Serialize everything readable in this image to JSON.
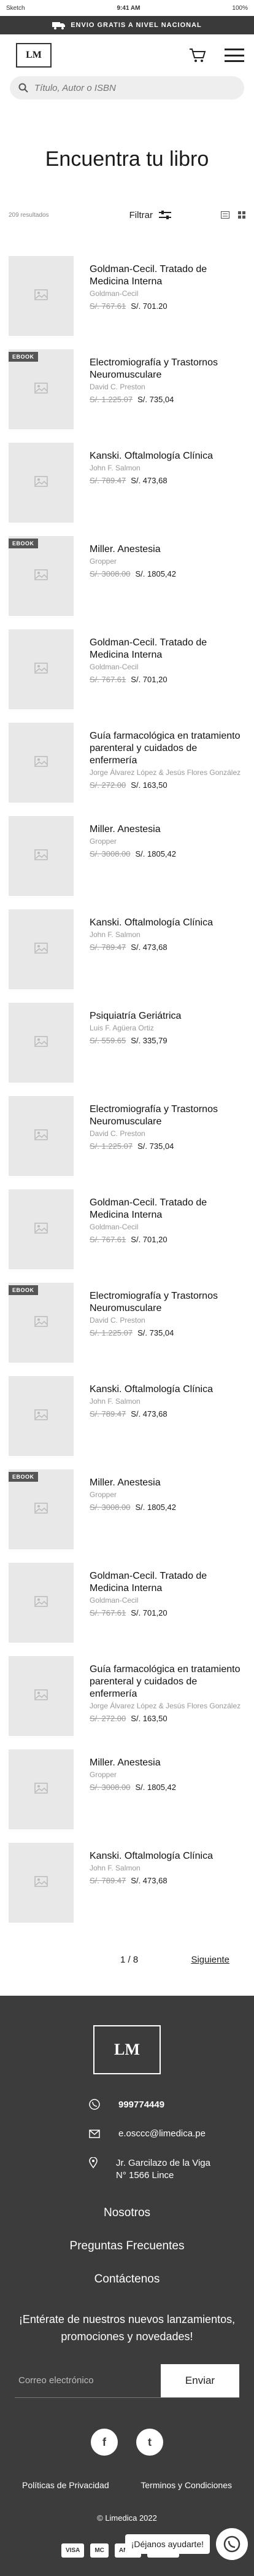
{
  "statusbar": {
    "carrier": "Sketch",
    "time": "9:41 AM",
    "battery": "100%"
  },
  "promo": {
    "text": "ENVIO GRATIS A NIVEL NACIONAL"
  },
  "header": {
    "logo": "LM"
  },
  "search": {
    "placeholder": "Título, Autor o ISBN"
  },
  "page": {
    "title": "Encuentra tu libro",
    "results": "209 resultados",
    "filter_label": "Filtrar"
  },
  "products": [
    {
      "badge": "",
      "title": "Goldman-Cecil. Tratado de Medicina Interna",
      "author": "Goldman-Cecil",
      "old_price": "S/. 767.61",
      "price": "S/. 701.20"
    },
    {
      "badge": "EBOOK",
      "title": "Electromiografía y Trastornos Neuromusculare",
      "author": "David C. Preston",
      "old_price": "S/. 1.225.07",
      "price": "S/. 735,04"
    },
    {
      "badge": "",
      "title": "Kanski. Oftalmología Clínica",
      "author": "John F. Salmon",
      "old_price": "S/. 789.47",
      "price": "S/. 473,68"
    },
    {
      "badge": "EBOOK",
      "title": "Miller. Anestesia",
      "author": "Gropper",
      "old_price": "S/. 3008.00",
      "price": "S/. 1805,42"
    },
    {
      "badge": "",
      "title": "Goldman-Cecil. Tratado de Medicina Interna",
      "author": "Goldman-Cecil",
      "old_price": "S/. 767.61",
      "price": "S/. 701,20"
    },
    {
      "badge": "",
      "title": "Guía farmacológica en tratamiento parenteral y cuidados de enfermería",
      "author": "Jorge Álvarez López & Jesús Flores González",
      "old_price": "S/. 272.00",
      "price": "S/. 163,50"
    },
    {
      "badge": "",
      "title": "Miller. Anestesia",
      "author": "Gropper",
      "old_price": "S/. 3008.00",
      "price": "S/. 1805,42"
    },
    {
      "badge": "",
      "title": "Kanski. Oftalmología Clínica",
      "author": "John F. Salmon",
      "old_price": "S/. 789.47",
      "price": "S/. 473,68"
    },
    {
      "badge": "",
      "title": "Psiquiatría Geriátrica",
      "author": "Luis F. Agüera Ortiz",
      "old_price": "S/. 559.65",
      "price": "S/. 335,79"
    },
    {
      "badge": "",
      "title": "Electromiografía y Trastornos Neuromusculare",
      "author": "David C. Preston",
      "old_price": "S/. 1.225.07",
      "price": "S/. 735,04"
    },
    {
      "badge": "",
      "title": "Goldman-Cecil. Tratado de Medicina Interna",
      "author": "Goldman-Cecil",
      "old_price": "S/. 767.61",
      "price": "S/. 701,20"
    },
    {
      "badge": "EBOOK",
      "title": "Electromiografía y Trastornos Neuromusculare",
      "author": "David C. Preston",
      "old_price": "S/. 1.225.07",
      "price": "S/. 735,04"
    },
    {
      "badge": "",
      "title": "Kanski. Oftalmología Clínica",
      "author": "John F. Salmon",
      "old_price": "S/. 789.47",
      "price": "S/. 473,68"
    },
    {
      "badge": "EBOOK",
      "title": "Miller. Anestesia",
      "author": "Gropper",
      "old_price": "S/. 3008.00",
      "price": "S/. 1805,42"
    },
    {
      "badge": "",
      "title": "Goldman-Cecil. Tratado de Medicina Interna",
      "author": "Goldman-Cecil",
      "old_price": "S/. 767.61",
      "price": "S/. 701,20"
    },
    {
      "badge": "",
      "title": "Guía farmacológica en tratamiento parenteral y cuidados de enfermería",
      "author": "Jorge Álvarez López & Jesús Flores González",
      "old_price": "S/. 272.00",
      "price": "S/. 163,50"
    },
    {
      "badge": "",
      "title": "Miller. Anestesia",
      "author": "Gropper",
      "old_price": "S/. 3008.00",
      "price": "S/. 1805,42"
    },
    {
      "badge": "",
      "title": "Kanski. Oftalmología Clínica",
      "author": "John F. Salmon",
      "old_price": "S/. 789.47",
      "price": "S/. 473,68"
    }
  ],
  "pagination": {
    "current": "1 / 8",
    "next": "Siguiente"
  },
  "footer": {
    "logo": "LM",
    "phone": "999774449",
    "email": "e.osccc@limedica.pe",
    "address_line1": "Jr. Garcilazo de la Viga",
    "address_line2": "N° 1566 Lince",
    "links": [
      "Nosotros",
      "Preguntas Frecuentes",
      "Contáctenos"
    ],
    "newsletter_text": "¡Entérate de nuestros nuevos lanzamientos, promociones y novedades!",
    "newsletter_placeholder": "Correo electrónico",
    "newsletter_button": "Enviar",
    "privacy": "Políticas de Privacidad",
    "terms": "Terminos y Condiciones",
    "copyright": "© Limedica 2022",
    "payments": [
      "VISA",
      "MC",
      "AMEX",
      "DINERS"
    ],
    "whatsapp_label": "¡Déjanos ayudarte!"
  }
}
